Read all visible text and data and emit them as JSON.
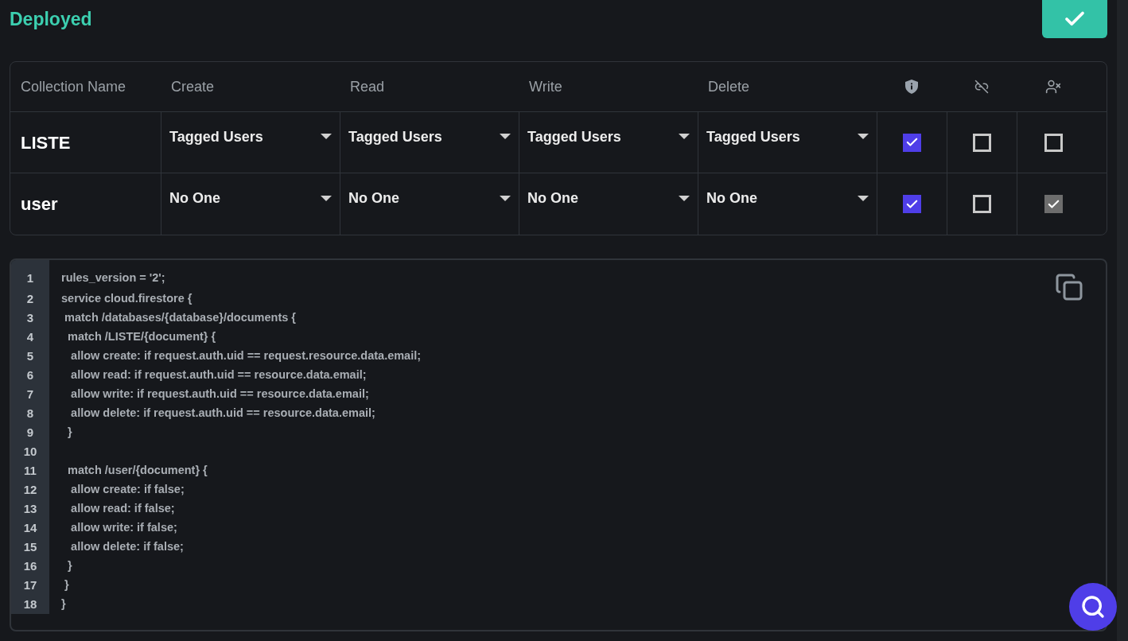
{
  "title": "Deployed",
  "table": {
    "columns": [
      "Collection Name",
      "Create",
      "Read",
      "Write",
      "Delete"
    ],
    "rows": [
      {
        "name": "LISTE",
        "permissions": [
          "Tagged Users",
          "Tagged Users",
          "Tagged Users",
          "Tagged Users"
        ],
        "flags": [
          {
            "checked": true
          },
          {
            "checked": false
          },
          {
            "checked": false
          }
        ]
      },
      {
        "name": "user",
        "permissions": [
          "No One",
          "No One",
          "No One",
          "No One"
        ],
        "flags": [
          {
            "checked": true
          },
          {
            "checked": false
          },
          {
            "checked": true
          }
        ]
      }
    ]
  },
  "code": {
    "lines": [
      {
        "number": "1",
        "text": "rules_version = '2';"
      },
      {
        "number": "2",
        "text": "service cloud.firestore {"
      },
      {
        "number": "3",
        "text": " match /databases/{database}/documents {"
      },
      {
        "number": "4",
        "text": "  match /LISTE/{document} {"
      },
      {
        "number": "5",
        "text": "   allow create: if request.auth.uid == request.resource.data.email;"
      },
      {
        "number": "6",
        "text": "   allow read: if request.auth.uid == resource.data.email;"
      },
      {
        "number": "7",
        "text": "   allow write: if request.auth.uid == resource.data.email;"
      },
      {
        "number": "8",
        "text": "   allow delete: if request.auth.uid == resource.data.email;"
      },
      {
        "number": "9",
        "text": "  }"
      },
      {
        "number": "10"
      },
      {
        "number": "11",
        "text": "  match /user/{document} {"
      },
      {
        "number": "12",
        "text": "   allow create: if false;"
      },
      {
        "number": "13",
        "text": "   allow read: if false;"
      },
      {
        "number": "14",
        "text": "   allow write: if false;"
      },
      {
        "number": "15",
        "text": "   allow delete: if false;"
      },
      {
        "number": "16",
        "text": "  }"
      },
      {
        "number": "17",
        "text": " }"
      },
      {
        "number": "18",
        "text": "}"
      }
    ]
  }
}
